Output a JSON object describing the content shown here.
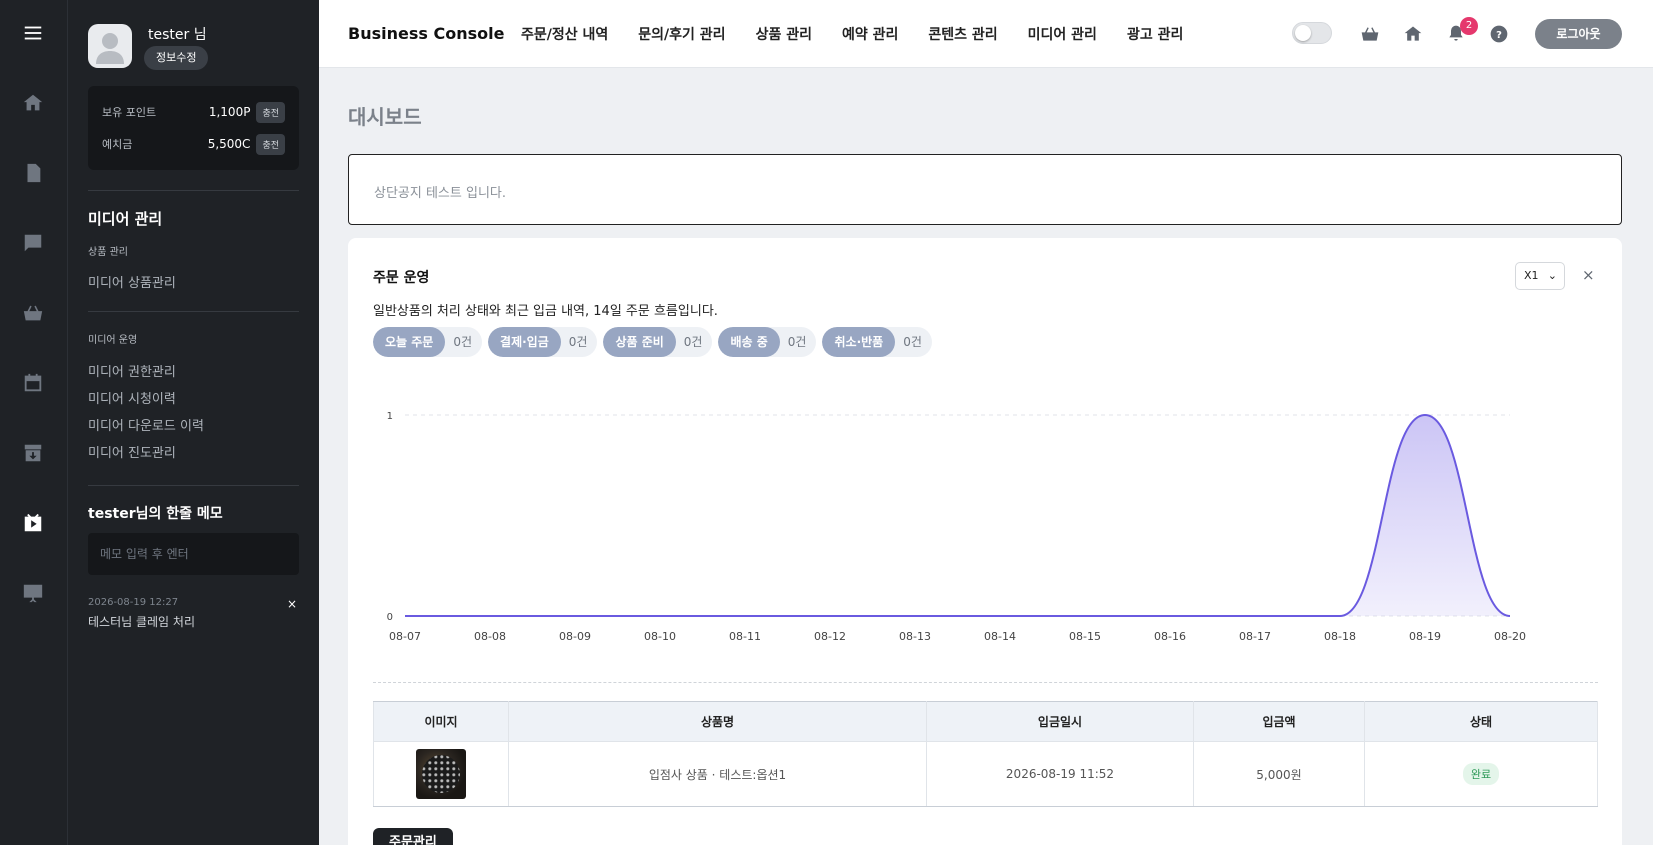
{
  "profile": {
    "name": "tester 님",
    "edit_label": "정보수정"
  },
  "wallet": {
    "points_label": "보유 포인트",
    "points_value": "1,100P",
    "points_charge": "충전",
    "deposit_label": "예치금",
    "deposit_value": "5,500C",
    "deposit_charge": "충전"
  },
  "sidebar": {
    "section_title": "미디어 관리",
    "group1_title": "상품 관리",
    "group1_items": [
      "미디어 상품관리"
    ],
    "group2_title": "미디어 운영",
    "group2_items": [
      "미디어 권한관리",
      "미디어 시청이력",
      "미디어 다운로드 이력",
      "미디어 진도관리"
    ]
  },
  "memo": {
    "title": "tester님의 한줄 메모",
    "placeholder": "메모 입력 후 엔터",
    "entry_date": "2026-08-19 12:27",
    "entry_text": "테스터님 클레임 처리",
    "close": "×"
  },
  "header": {
    "brand": "Business Console",
    "nav": [
      "주문/정산 내역",
      "문의/후기 관리",
      "상품 관리",
      "예약 관리",
      "콘텐츠 관리",
      "미디어 관리",
      "광고 관리"
    ],
    "notification_count": "2",
    "logout_label": "로그아웃"
  },
  "page": {
    "title": "대시보드",
    "notice": "상단공지 테스트 입니다."
  },
  "card": {
    "title": "주문 운영",
    "description": "일반상품의 처리 상태와 최근 입금 내역, 14일 주문 흐름입니다.",
    "zoom_value": "X1",
    "close": "×",
    "chips": [
      {
        "label": "오늘 주문",
        "value": "0건"
      },
      {
        "label": "결제·입금",
        "value": "0건"
      },
      {
        "label": "상품 준비",
        "value": "0건"
      },
      {
        "label": "배송 중",
        "value": "0건"
      },
      {
        "label": "취소·반품",
        "value": "0건"
      }
    ],
    "manage_label": "주문관리"
  },
  "chart_data": {
    "type": "area",
    "x": [
      "08-07",
      "08-08",
      "08-09",
      "08-10",
      "08-11",
      "08-12",
      "08-13",
      "08-14",
      "08-15",
      "08-16",
      "08-17",
      "08-18",
      "08-19",
      "08-20"
    ],
    "y_ticks": [
      "0",
      "1"
    ],
    "series": [
      {
        "values": [
          0,
          0,
          0,
          0,
          0,
          0,
          0,
          0,
          0,
          0,
          0,
          0,
          1,
          0
        ]
      }
    ],
    "ylim": [
      0,
      1
    ],
    "line_color": "#6a5ae0",
    "fill_color": "#c9c2f5",
    "grid": "dashed horizontal at top"
  },
  "orders_table": {
    "columns": [
      "이미지",
      "상품명",
      "입금일시",
      "입금액",
      "상태"
    ],
    "rows": [
      {
        "product": "입점사 상품 · 테스트:옵션1",
        "date": "2026-08-19 11:52",
        "amount": "5,000원",
        "status": "완료"
      }
    ]
  },
  "colors": {
    "sidebar_bg": "#1f2226",
    "chip_label_bg": "#98a6c2",
    "badge": "#e5386d",
    "status_done": "#2e9a58"
  }
}
